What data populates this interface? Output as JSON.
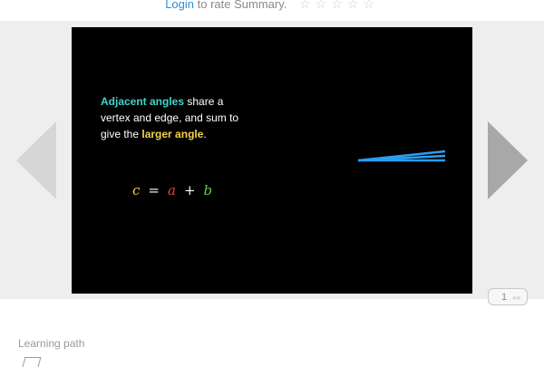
{
  "header": {
    "login_label": "Login",
    "rate_text": " to rate Summary.",
    "stars": [
      "☆",
      "☆",
      "☆",
      "☆",
      "☆"
    ]
  },
  "slide": {
    "text_part1": "Adjacent angles",
    "text_part2": " share a vertex and edge, and sum to give the ",
    "text_part3": "larger angle",
    "text_part4": ".",
    "equation": {
      "c": "c",
      "eq": "=",
      "a": "a",
      "plus": "+",
      "b": "b"
    }
  },
  "pager": {
    "current": "1",
    "more": "»»"
  },
  "section": {
    "learning_path_label": "Learning path"
  },
  "colors": {
    "cyan": "#3fd6c9",
    "yellow": "#f3d24a",
    "red": "#e04040",
    "green": "#66cc44",
    "line_blue": "#2a9ff0"
  },
  "icons": {
    "prev": "left-triangle",
    "next": "right-triangle",
    "path": "path-icon"
  }
}
